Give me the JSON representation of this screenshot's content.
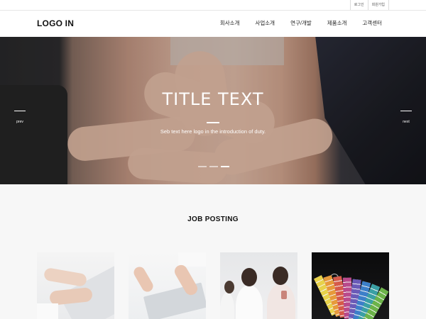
{
  "util": {
    "login": "로그인",
    "join": "회원가입"
  },
  "header": {
    "logo": "LOGO IN",
    "nav": [
      "회사소개",
      "사업소개",
      "연구/개발",
      "제품소개",
      "고객센터"
    ]
  },
  "hero": {
    "title": "TITLE TEXT",
    "subtitle": "Seb text here logo in the introduction of duty.",
    "prev_label": "prev",
    "next_label": "next",
    "slide_count": 3,
    "active_slide": 3
  },
  "section": {
    "title": "JOB POSTING"
  },
  "cards": [
    {
      "icon": "photo-typing-hands"
    },
    {
      "icon": "photo-laptop-desk"
    },
    {
      "icon": "photo-women-coffee"
    },
    {
      "icon": "photo-color-swatches"
    }
  ],
  "colors": {
    "text": "#222222",
    "content_bg": "#f7f7f7",
    "hero_text": "#ffffff"
  }
}
